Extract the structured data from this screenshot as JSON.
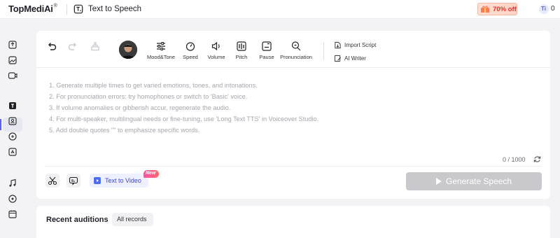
{
  "app": {
    "logo": "TopMediAi",
    "logo_mark": "®",
    "page_title": "Text to Speech"
  },
  "promo": {
    "label": "70% off",
    "color": "#e0312c"
  },
  "credits": {
    "icon": "coin-icon",
    "value": "0"
  },
  "sidebar": {
    "items": [
      "upload-icon",
      "image-icon",
      "video-icon",
      "text-to-speech-icon",
      "voice-clone-icon",
      "dubbing-icon",
      "translate-icon",
      "music-icon",
      "vocal-icon",
      "calendar-icon"
    ],
    "active_index": 3,
    "accent": "#5a64f0"
  },
  "toolbar": {
    "tools": [
      {
        "name": "mood-tone",
        "label": "Mood&Tone"
      },
      {
        "name": "speed",
        "label": "Speed"
      },
      {
        "name": "volume",
        "label": "Volume"
      },
      {
        "name": "pitch",
        "label": "Pitch"
      },
      {
        "name": "pause",
        "label": "Pause"
      },
      {
        "name": "pronunciation",
        "label": "Pronunciation"
      }
    ],
    "import_script": "Import Script",
    "ai_writer": "AI Writer"
  },
  "editor": {
    "hints": [
      "1. Generate multiple times to get varied emotions, tones, and intonations.",
      "2. For pronunciation errors: try homophones or switch to 'Basic' voice.",
      "3. If volume anomalies or gibberish accur, regenerate the audio.",
      "4. For multi-speaker, multilingual needs or fine-tuning, use 'Long Text TTS' in Voiceover Studio.",
      "5. Add double quotes \"\" to emphasize specific words."
    ],
    "counter": "0 / 1000"
  },
  "actions": {
    "text_to_video": "Text to Video",
    "new_badge": "New",
    "generate": "Generate Speech"
  },
  "recent": {
    "title": "Recent auditions",
    "filter": "All records"
  }
}
